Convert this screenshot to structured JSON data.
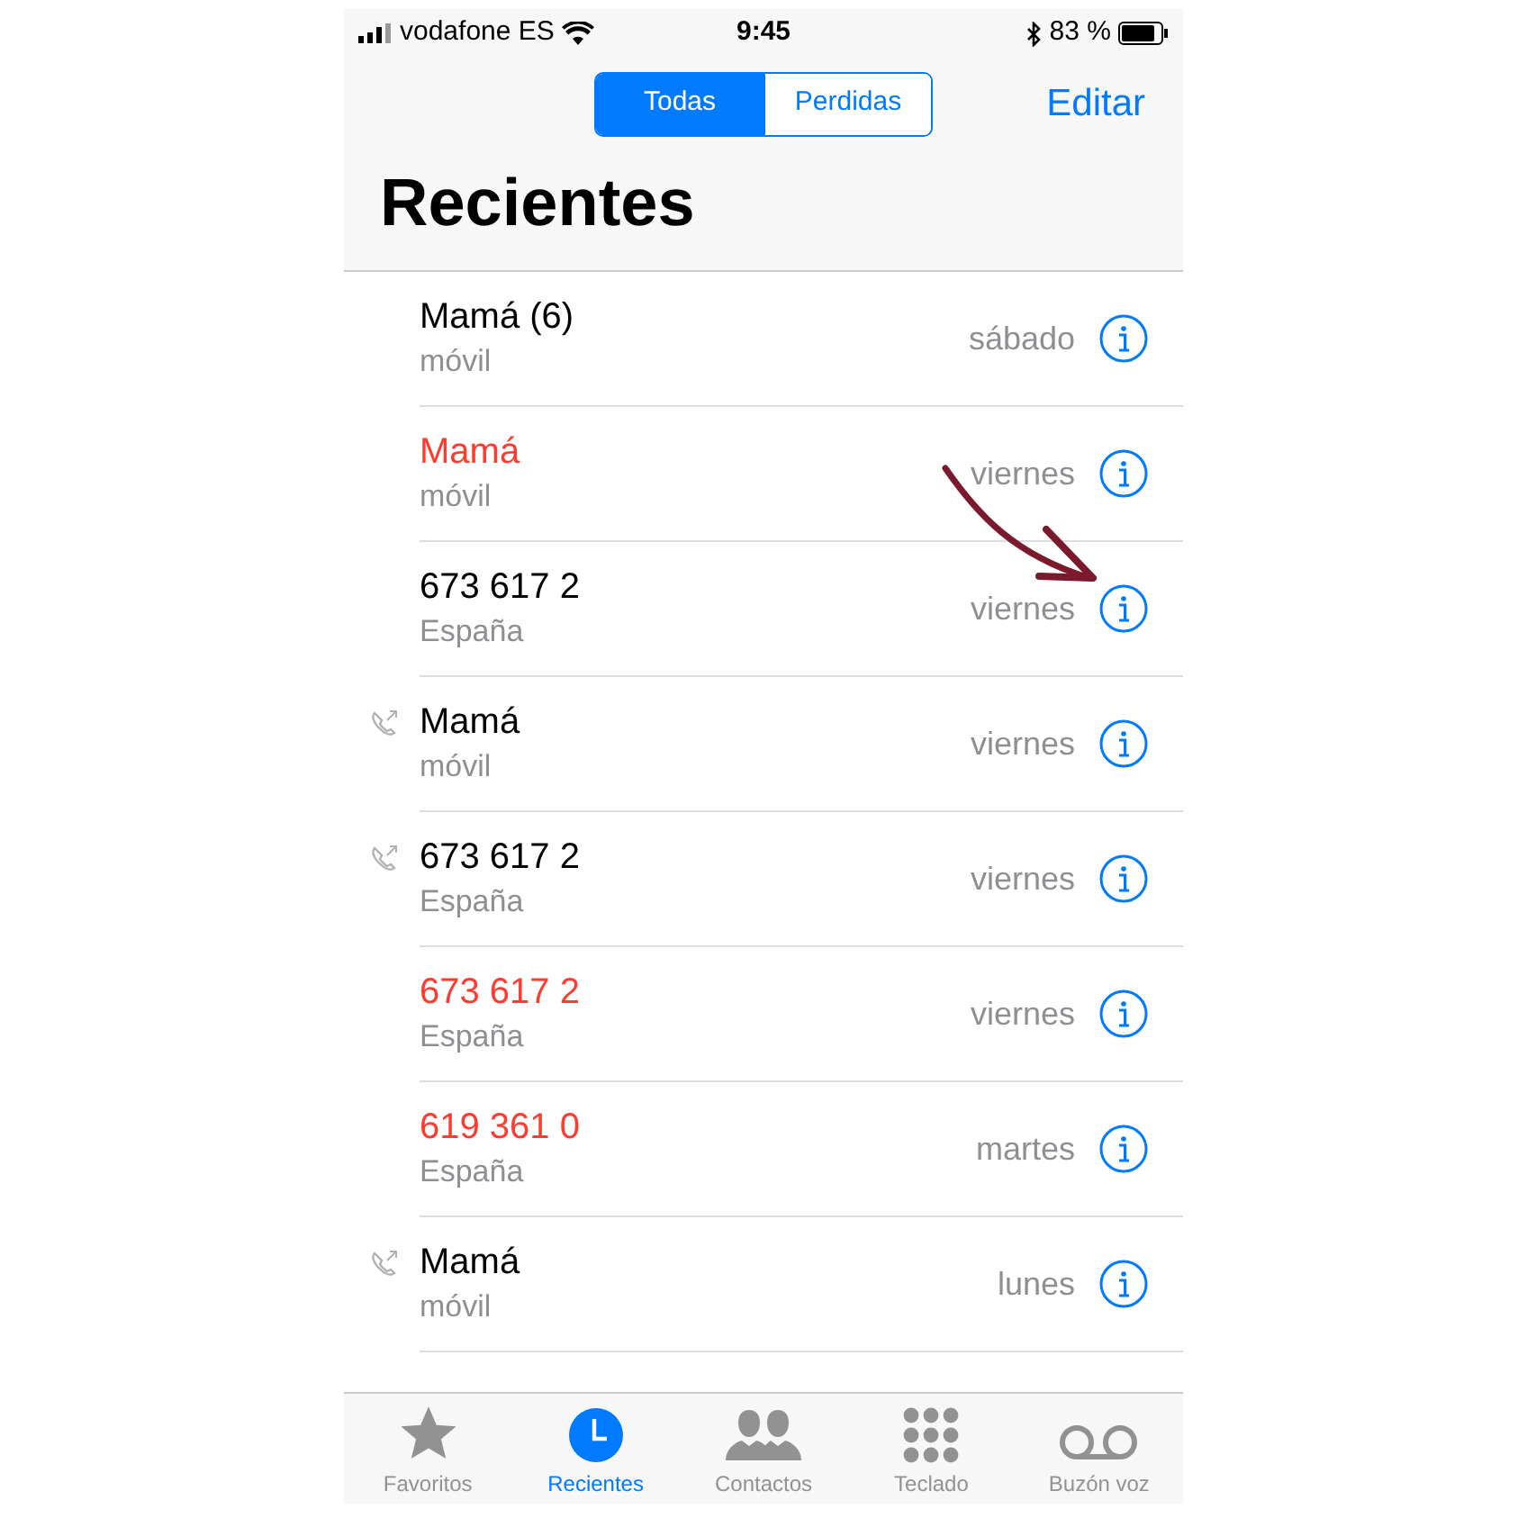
{
  "status_bar": {
    "carrier": "vodafone ES",
    "time": "9:45",
    "battery": "83 %"
  },
  "segments": [
    {
      "label": "Todas",
      "selected": true
    },
    {
      "label": "Perdidas",
      "selected": false
    }
  ],
  "edit_button": "Editar",
  "title": "Recientes",
  "calls": [
    {
      "name": "Mamá (6)",
      "detail": "móvil",
      "day": "sábado",
      "missed": false,
      "outgoing": false
    },
    {
      "name": "Mamá",
      "detail": "móvil",
      "day": "viernes",
      "missed": true,
      "outgoing": false
    },
    {
      "name": "673 617 2",
      "detail": "España",
      "day": "viernes",
      "missed": false,
      "outgoing": false
    },
    {
      "name": "Mamá",
      "detail": "móvil",
      "day": "viernes",
      "missed": false,
      "outgoing": true
    },
    {
      "name": "673 617 2",
      "detail": "España",
      "day": "viernes",
      "missed": false,
      "outgoing": true
    },
    {
      "name": "673 617 2",
      "detail": "España",
      "day": "viernes",
      "missed": true,
      "outgoing": false
    },
    {
      "name": "619 361 0",
      "detail": "España",
      "day": "martes",
      "missed": true,
      "outgoing": false
    },
    {
      "name": "Mamá",
      "detail": "móvil",
      "day": "lunes",
      "missed": false,
      "outgoing": true
    }
  ],
  "tabs": [
    {
      "kind": "star",
      "label": "Favoritos",
      "selected": false
    },
    {
      "kind": "clock",
      "label": "Recientes",
      "selected": true
    },
    {
      "kind": "contacts",
      "label": "Contactos",
      "selected": false
    },
    {
      "kind": "keypad",
      "label": "Teclado",
      "selected": false
    },
    {
      "kind": "voicemail",
      "label": "Buzón voz",
      "selected": false
    }
  ]
}
